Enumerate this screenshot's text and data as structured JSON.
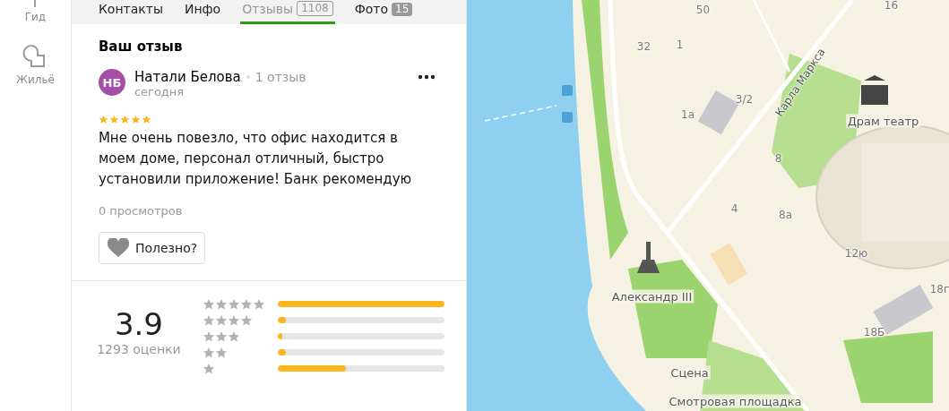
{
  "nav": [
    {
      "label": "Гид"
    },
    {
      "label": "Жильё"
    }
  ],
  "tabs": [
    {
      "label": "Контакты",
      "selected": false
    },
    {
      "label": "Инфо",
      "selected": false
    },
    {
      "label": "Отзывы",
      "count": "1108",
      "selected": true
    },
    {
      "label": "Фото",
      "count": "15",
      "selected": false
    }
  ],
  "review": {
    "heading": "Ваш отзыв",
    "initials": "НБ",
    "author": "Натали Белова",
    "author_reviews": "1 отзыв",
    "date": "сегодня",
    "stars": 5,
    "text": "Мне очень повезло, что офис находится в моем доме, персонал отличный, быстро установили приложение! Банк рекомендую",
    "views": "0 просмотров",
    "helpful_button": "Полезно?"
  },
  "summary": {
    "score": "3.9",
    "count": "1293 оценки",
    "bars": [
      {
        "level": 1.0
      },
      {
        "level": 0.05
      },
      {
        "level": 0.03
      },
      {
        "level": 0.05
      },
      {
        "level": 0.41
      }
    ]
  },
  "map": {
    "labels": [
      {
        "text": "50",
        "kind": "house"
      },
      {
        "text": "16",
        "kind": "house"
      },
      {
        "text": "32",
        "kind": "house"
      },
      {
        "text": "1",
        "kind": "house"
      },
      {
        "text": "1а",
        "kind": "house"
      },
      {
        "text": "3/2",
        "kind": "house"
      },
      {
        "text": "Карла Маркса",
        "kind": "street"
      },
      {
        "text": "Драм театр",
        "kind": "poi"
      },
      {
        "text": "8",
        "kind": "house"
      },
      {
        "text": "4",
        "kind": "house"
      },
      {
        "text": "8а",
        "kind": "house"
      },
      {
        "text": "12ю",
        "kind": "house"
      },
      {
        "text": "Александр III",
        "kind": "poi"
      },
      {
        "text": "18г",
        "kind": "house"
      },
      {
        "text": "18Б",
        "kind": "house"
      },
      {
        "text": "Сцена",
        "kind": "poi"
      },
      {
        "text": "Смотровая площадка",
        "kind": "poi"
      }
    ]
  }
}
